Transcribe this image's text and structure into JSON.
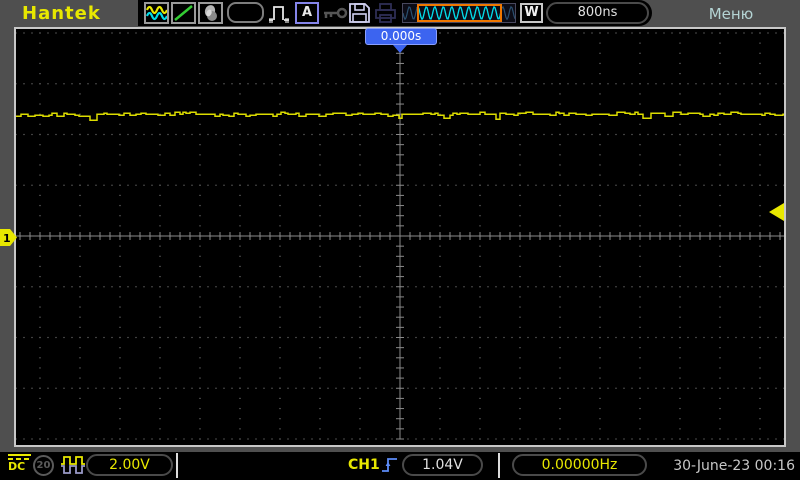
{
  "brand": "Hantek",
  "top_bar": {
    "menu_label": "Меню",
    "timebase": "800ns",
    "auto_mode_label": "A",
    "w_label": "W"
  },
  "trigger_balloon_label": "0.000s",
  "channel_marker_label": "1",
  "bottom_bar": {
    "coupling_label": "DC",
    "bandwidth_label": "20",
    "volts_per_div": "2.00V",
    "trigger_source": "CH1",
    "trigger_level": "1.04V",
    "frequency": "0.00000Hz",
    "datetime": "30-June-23 00:16"
  },
  "colors": {
    "trace_yellow": "#dcdc00",
    "accent_yellow": "#e8e800",
    "preview_cyan": "#00dce8",
    "balloon_blue": "#3c64f0",
    "zoom_window_orange": "#f07800",
    "ramp_green": "#33cc33",
    "grid_dot": "#6a6a6a",
    "center_axis": "#8a8a8a"
  },
  "chart_data": {
    "type": "line",
    "title": "Oscilloscope CH1 trace",
    "x_units": "time",
    "y_units": "volts",
    "time_per_div": "800ns",
    "volts_per_div": 2.0,
    "vertical_divisions": 8,
    "horizontal_divisions": 19.2,
    "grid": "dotted, center crosshair with minor ticks",
    "series": [
      {
        "name": "CH1",
        "shape": "flat noisy horizontal line",
        "mean_level_volts": 4.8,
        "noise_peak_to_peak_volts": 0.3,
        "occasional_dips_volts": -0.25
      }
    ],
    "trigger": {
      "position": "0.000s",
      "level_volts": 1.04,
      "source": "CH1",
      "slope": "rising",
      "mode": "A"
    },
    "channel_zero_reference": "screen center",
    "measured_frequency": "0.00000Hz"
  }
}
